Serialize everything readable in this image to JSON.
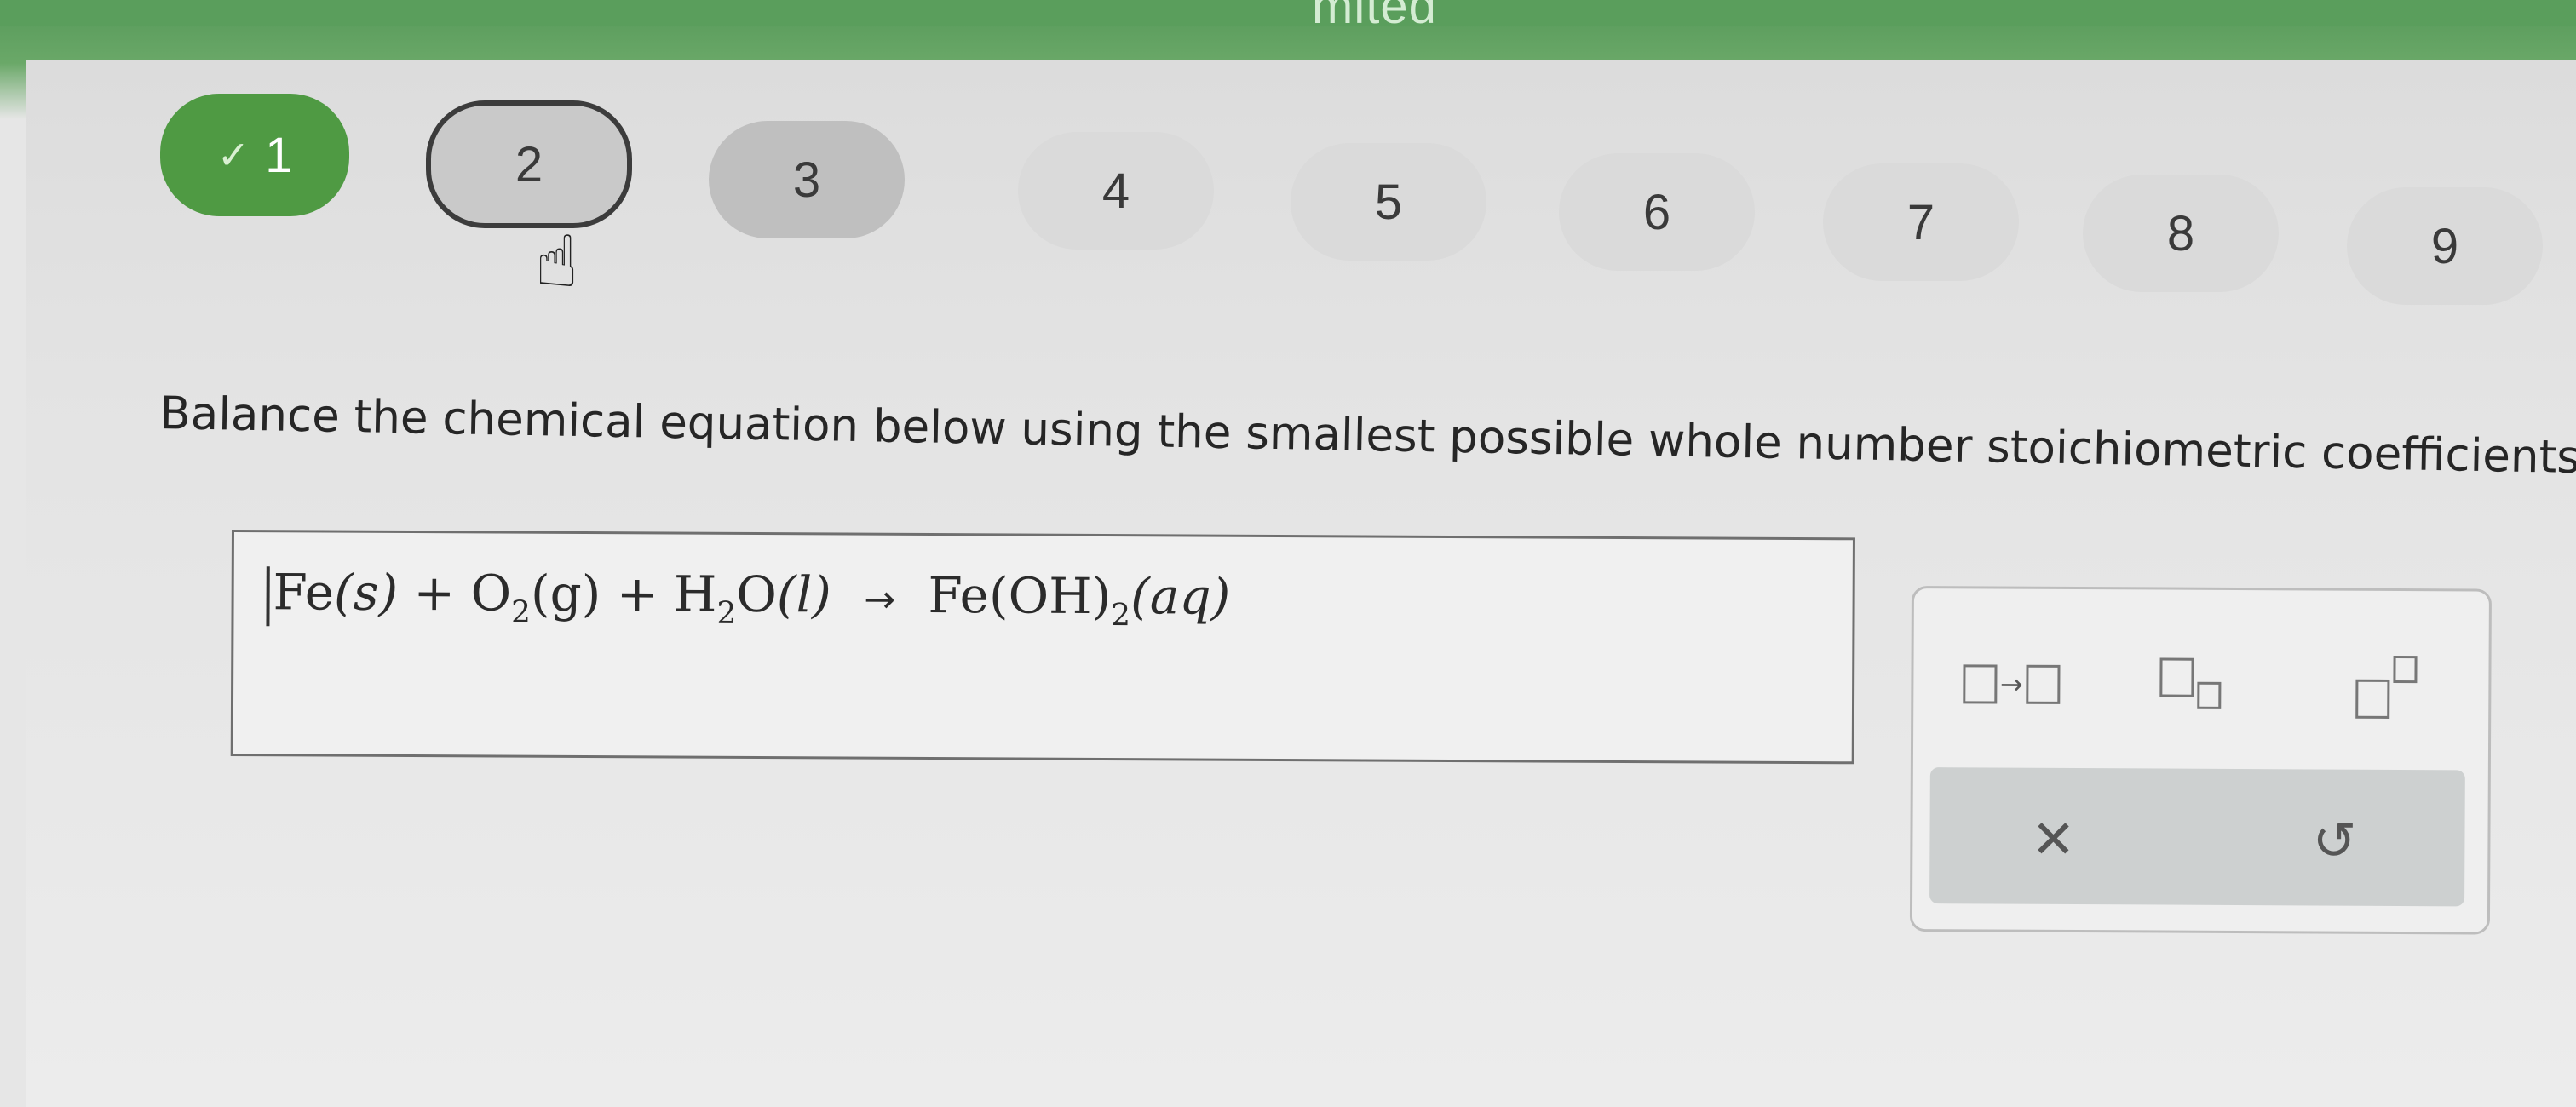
{
  "header": {
    "attempt_text": "mited"
  },
  "question_nav": {
    "items": [
      {
        "label": "1",
        "state": "completed",
        "check": "✓"
      },
      {
        "label": "2",
        "state": "current"
      },
      {
        "label": "3",
        "state": "visited"
      },
      {
        "label": "4",
        "state": "default"
      },
      {
        "label": "5",
        "state": "default"
      },
      {
        "label": "6",
        "state": "default"
      },
      {
        "label": "7",
        "state": "default"
      },
      {
        "label": "8",
        "state": "default"
      },
      {
        "label": "9",
        "state": "default"
      }
    ]
  },
  "question": {
    "prompt": "Balance the chemical equation below using the smallest possible whole number stoichiometric coefficients."
  },
  "equation": {
    "r1": "Fe",
    "r1_state": "(s)",
    "plus1": "+",
    "r2": "O",
    "r2_sub": "2",
    "r2_state": "(g)",
    "plus2": "+",
    "r3a": "H",
    "r3_sub": "2",
    "r3b": "O",
    "r3_state": "(l)",
    "arrow": "→",
    "p1a": "Fe(OH)",
    "p1_sub": "2",
    "p1_state": "(aq)"
  },
  "tools": {
    "items": [
      "reaction-arrow-icon",
      "subscript-icon",
      "superscript-icon"
    ],
    "clear_glyph": "✕",
    "undo_glyph": "↺"
  },
  "colors": {
    "header_green": "#5a9e5c",
    "completed_green": "#4f9a43"
  }
}
